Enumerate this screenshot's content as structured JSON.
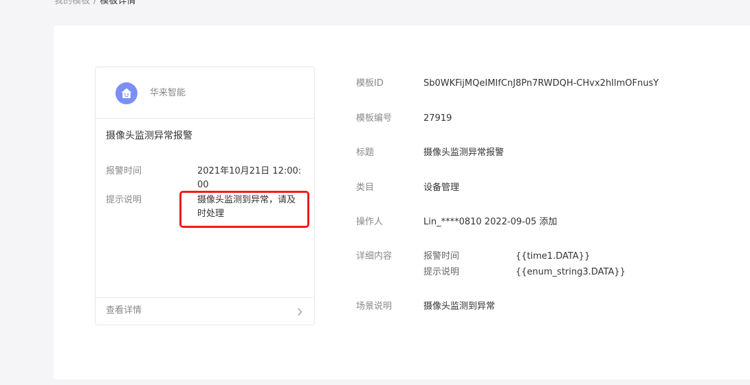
{
  "breadcrumb": {
    "parent": "我的模板",
    "separator": "/",
    "current": "模板详情"
  },
  "preview": {
    "app_name": "华来智能",
    "avatar_icon": "house-face-icon",
    "avatar_color": "#7b8ff7",
    "title": "摄像头监测异常报警",
    "fields": [
      {
        "label": "报警时间",
        "value": "2021年10月21日 12:00:00"
      },
      {
        "label": "提示说明",
        "value": "摄像头监测到异常，请及时处理"
      }
    ],
    "footer_label": "查看详情",
    "footer_icon": "chevron-right-icon",
    "highlight_color": "#ee1b1b"
  },
  "details": {
    "template_id": {
      "label": "模板ID",
      "value": "Sb0WKFijMQeIMIfCnJ8Pn7RWDQH-CHvx2hIlmOFnusY"
    },
    "template_number": {
      "label": "模板编号",
      "value": "27919"
    },
    "title": {
      "label": "标题",
      "value": "摄像头监测异常报警"
    },
    "category": {
      "label": "类目",
      "value": "设备管理"
    },
    "operator": {
      "label": "操作人",
      "value": "Lin_****0810 2022-09-05 添加"
    },
    "content": {
      "label": "详细内容",
      "rows": [
        {
          "label": "报警时间",
          "value": "{{time1.DATA}}"
        },
        {
          "label": "提示说明",
          "value": "{{enum_string3.DATA}}"
        }
      ]
    },
    "scene": {
      "label": "场景说明",
      "value": "摄像头监测到异常"
    }
  }
}
